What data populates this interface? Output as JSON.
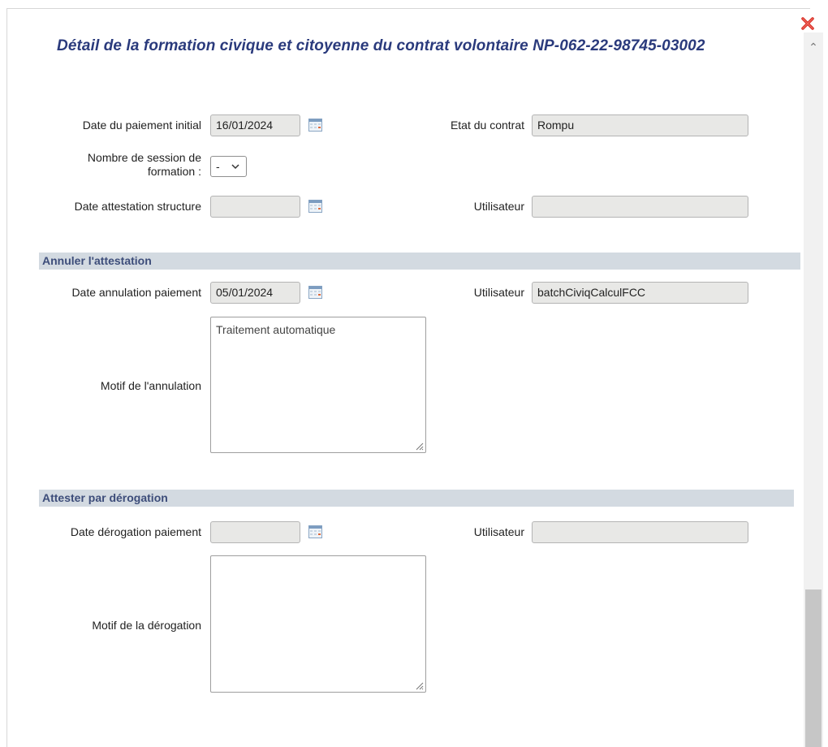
{
  "title": "Détail de la formation civique et citoyenne du contrat volontaire NP-062-22-98745-03002",
  "general": {
    "date_paiement_initial": {
      "label": "Date du paiement initial",
      "value": "16/01/2024"
    },
    "etat_contrat": {
      "label": "Etat du contrat",
      "value": "Rompu"
    },
    "nombre_session": {
      "label_line1": "Nombre de session de",
      "label_line2": "formation :",
      "selected": "-"
    },
    "date_attestation_structure": {
      "label": "Date attestation structure",
      "value": ""
    },
    "utilisateur": {
      "label": "Utilisateur",
      "value": ""
    }
  },
  "annuler": {
    "header": "Annuler l'attestation",
    "date_annulation": {
      "label": "Date annulation paiement",
      "value": "05/01/2024"
    },
    "utilisateur": {
      "label": "Utilisateur",
      "value": "batchCiviqCalculFCC"
    },
    "motif": {
      "label": "Motif de l'annulation",
      "value": "Traitement automatique"
    }
  },
  "derogation": {
    "header": "Attester par dérogation",
    "date_derogation": {
      "label": "Date dérogation paiement",
      "value": ""
    },
    "utilisateur": {
      "label": "Utilisateur",
      "value": ""
    },
    "motif": {
      "label": "Motif de la dérogation",
      "value": ""
    }
  },
  "icons": {
    "close": "close-icon",
    "calendar": "calendar-icon",
    "scroll_up": "scroll-up-icon",
    "select_chevron": "chevron-down-icon"
  },
  "colors": {
    "title": "#2a3a7c",
    "section_header_bg": "#d3dae1",
    "section_header_text": "#3d4d7a",
    "readonly_field_bg": "#e8e8e6",
    "close_red": "#d9342b"
  }
}
